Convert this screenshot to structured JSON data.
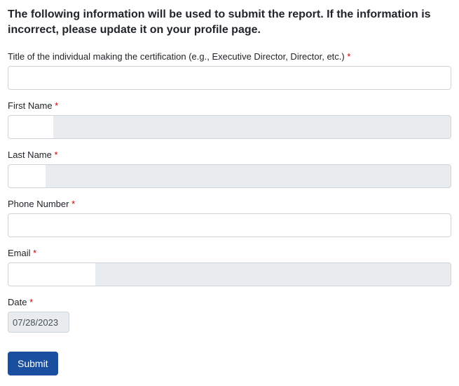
{
  "heading": "The following information will be used to submit the report. If the information is incorrect, please update it on your profile page.",
  "fields": {
    "title": {
      "label": "Title of the individual making the certification (e.g., Executive Director, Director, etc.) ",
      "value": ""
    },
    "first_name": {
      "label": "First Name ",
      "value": ""
    },
    "last_name": {
      "label": "Last Name ",
      "value": ""
    },
    "phone": {
      "label": "Phone Number ",
      "value": ""
    },
    "email": {
      "label": "Email ",
      "value": ""
    },
    "date": {
      "label": "Date ",
      "value": "07/28/2023"
    }
  },
  "required_mark": "*",
  "submit_label": "Submit"
}
